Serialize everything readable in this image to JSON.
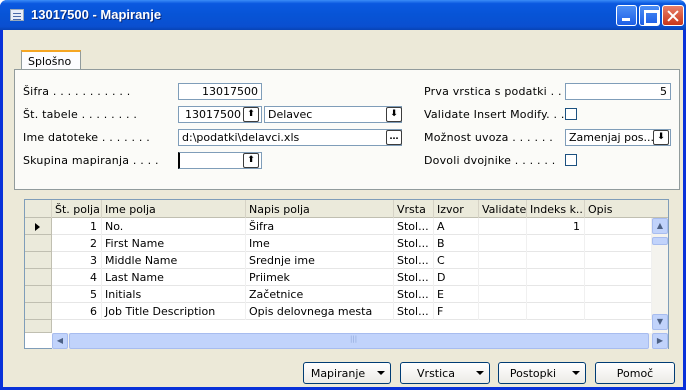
{
  "window": {
    "title": "13017500 - Mapiranje"
  },
  "tabs": [
    {
      "label": "Splošno"
    }
  ],
  "general": {
    "sifra": {
      "label": "Šifra . . . . . . . . . . .",
      "value": "13017500"
    },
    "st_tabele": {
      "label": "Št. tabele . . . . . . . .",
      "value": "13017500",
      "name": "Delavec"
    },
    "ime_datoteke": {
      "label": "Ime datoteke . . . . . . .",
      "value": "d:\\podatki\\delavci.xls"
    },
    "skupina": {
      "label": "Skupina mapiranja . . . .",
      "value": ""
    },
    "prva_vrstica": {
      "label": "Prva vrstica s podatki . . .",
      "value": "5"
    },
    "validate": {
      "label": "Validate Insert Modify. . .",
      "checked": false
    },
    "moznost": {
      "label": "Možnost uvoza . . . . . .",
      "value": "Zamenjaj pos..."
    },
    "dovoli": {
      "label": "Dovoli dvojnike . . . . . .",
      "checked": false
    }
  },
  "grid": {
    "columns": [
      "Št. polja",
      "Ime polja",
      "Napis polja",
      "Vrsta",
      "Izvor",
      "Validate",
      "Indeks k...",
      "Opis"
    ],
    "rows": [
      {
        "no": "1",
        "name": "No.",
        "caption": "Šifra",
        "type": "Stol...",
        "src": "A",
        "validate": "",
        "index": "1",
        "desc": ""
      },
      {
        "no": "2",
        "name": "First Name",
        "caption": "Ime",
        "type": "Stol...",
        "src": "B",
        "validate": "",
        "index": "",
        "desc": ""
      },
      {
        "no": "3",
        "name": "Middle Name",
        "caption": "Srednje ime",
        "type": "Stol...",
        "src": "C",
        "validate": "",
        "index": "",
        "desc": ""
      },
      {
        "no": "4",
        "name": "Last Name",
        "caption": "Priimek",
        "type": "Stol...",
        "src": "D",
        "validate": "",
        "index": "",
        "desc": ""
      },
      {
        "no": "5",
        "name": "Initials",
        "caption": "Začetnice",
        "type": "Stol...",
        "src": "E",
        "validate": "",
        "index": "",
        "desc": ""
      },
      {
        "no": "6",
        "name": "Job Title Description",
        "caption": "Opis delovnega mesta",
        "type": "Stol...",
        "src": "F",
        "validate": "",
        "index": "",
        "desc": ""
      }
    ]
  },
  "buttons": {
    "mapiranje": "Mapiranje",
    "vrstica": "Vrstica",
    "postopki": "Postopki",
    "pomoc": "Pomoč"
  },
  "icons": {
    "lookup": "lookup-arrow-icon",
    "dropdown": "dropdown-icon",
    "assist": "assist-edit-icon"
  }
}
